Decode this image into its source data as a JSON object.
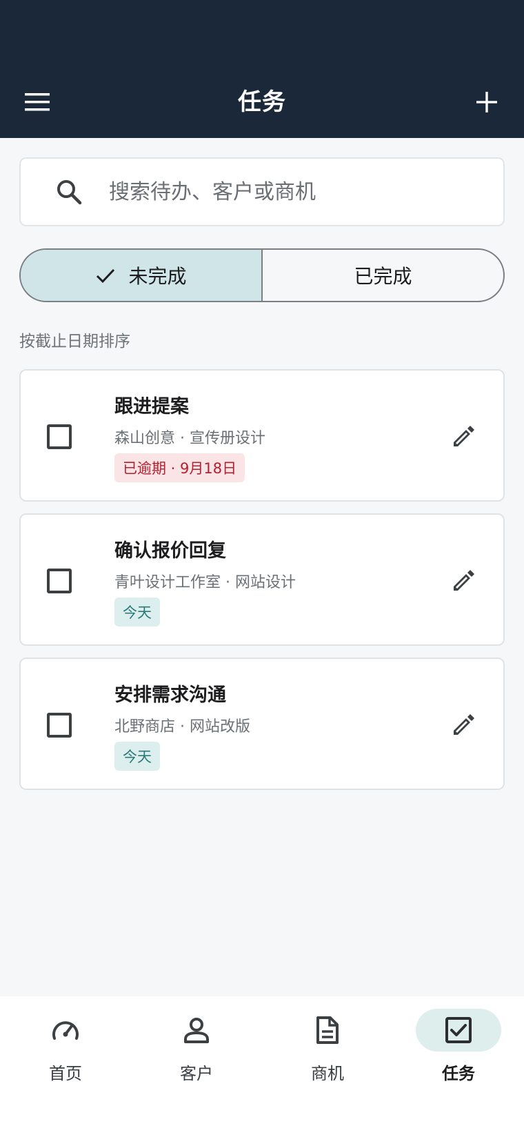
{
  "header": {
    "title": "任务",
    "menu_icon": "menu-icon",
    "add_icon": "plus-icon",
    "background": "#1a2839"
  },
  "search": {
    "placeholder": "搜索待办、客户或商机",
    "value": ""
  },
  "filter": {
    "options": [
      {
        "label": "未完成",
        "selected": true
      },
      {
        "label": "已完成",
        "selected": false
      }
    ]
  },
  "sort_label": "按截止日期排序",
  "tasks": [
    {
      "title": "跟进提案",
      "subtitle": "森山创意 · 宣传册设计",
      "badge": "已逾期 · 9月18日",
      "status": "overdue",
      "checked": false
    },
    {
      "title": "确认报价回复",
      "subtitle": "青叶设计工作室 · 网站设计",
      "badge": "今天",
      "status": "today",
      "checked": false
    },
    {
      "title": "安排需求沟通",
      "subtitle": "北野商店 · 网站改版",
      "badge": "今天",
      "status": "today",
      "checked": false
    }
  ],
  "bottom_nav": [
    {
      "label": "首页",
      "icon": "speedometer-icon",
      "active": false
    },
    {
      "label": "客户",
      "icon": "person-icon",
      "active": false
    },
    {
      "label": "商机",
      "icon": "document-icon",
      "active": false
    },
    {
      "label": "任务",
      "icon": "checkbox-icon",
      "active": true
    }
  ],
  "colors": {
    "accent_bg": "#cfe5e8",
    "overdue_text": "#b3202f",
    "overdue_bg": "#fbe4e6",
    "today_text": "#2c7a78",
    "today_bg": "#dcefee"
  }
}
